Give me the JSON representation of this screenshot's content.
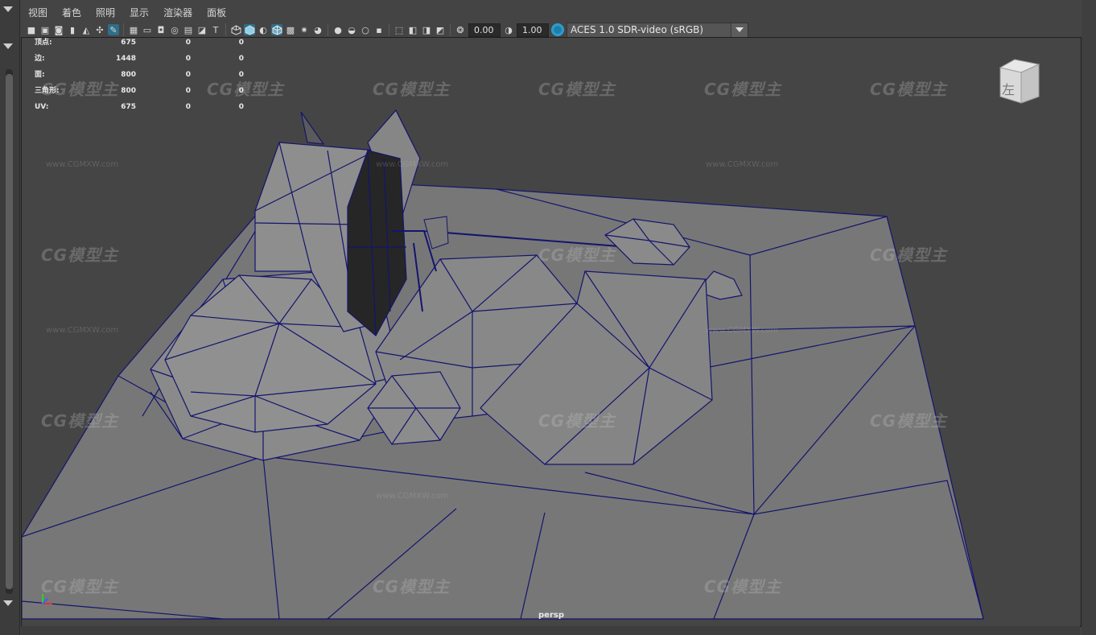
{
  "menu": {
    "items": [
      "视图",
      "着色",
      "照明",
      "显示",
      "渲染器",
      "面板"
    ]
  },
  "toolbar": {
    "gamma_value": "0.00",
    "exposure_value": "1.00",
    "color_space": "ACES 1.0 SDR-video (sRGB)"
  },
  "hud": {
    "rows": [
      {
        "label": "顶点:",
        "v1": "675",
        "v2": "0",
        "v3": "0"
      },
      {
        "label": "边:",
        "v1": "1448",
        "v2": "0",
        "v3": "0"
      },
      {
        "label": "面:",
        "v1": "800",
        "v2": "0",
        "v3": "0"
      },
      {
        "label": "三角形:",
        "v1": "800",
        "v2": "0",
        "v3": "0"
      },
      {
        "label": "UV:",
        "v1": "675",
        "v2": "0",
        "v3": "0"
      }
    ]
  },
  "viewport": {
    "camera_label": "persp",
    "view_cube_label": "左",
    "watermark_text": "CG模型主",
    "watermark_url": "www.CGMXW.com"
  },
  "colors": {
    "wireframe": "#14146e",
    "mesh_fill": "#7a7a7a",
    "accent": "#2e6e8a"
  }
}
